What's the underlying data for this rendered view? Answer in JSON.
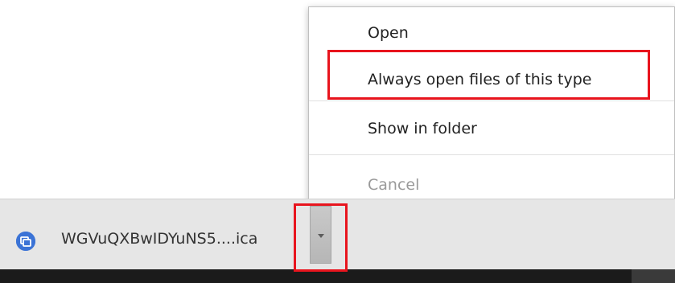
{
  "download_shelf": {
    "file_name": "WGVuQXBwIDYuNS5....ica",
    "icon": "citrix-receiver-icon",
    "dropdown_icon": "chevron-down-icon"
  },
  "context_menu": {
    "items": [
      {
        "label": "Open",
        "enabled": true
      },
      {
        "label": "Always open files of this type",
        "enabled": true
      },
      {
        "label": "Show in folder",
        "enabled": true
      },
      {
        "label": "Cancel",
        "enabled": false
      }
    ]
  },
  "colors": {
    "highlight_red": "#e8141d",
    "shelf_bg": "#e6e6e6",
    "icon_blue": "#3b73d6"
  }
}
